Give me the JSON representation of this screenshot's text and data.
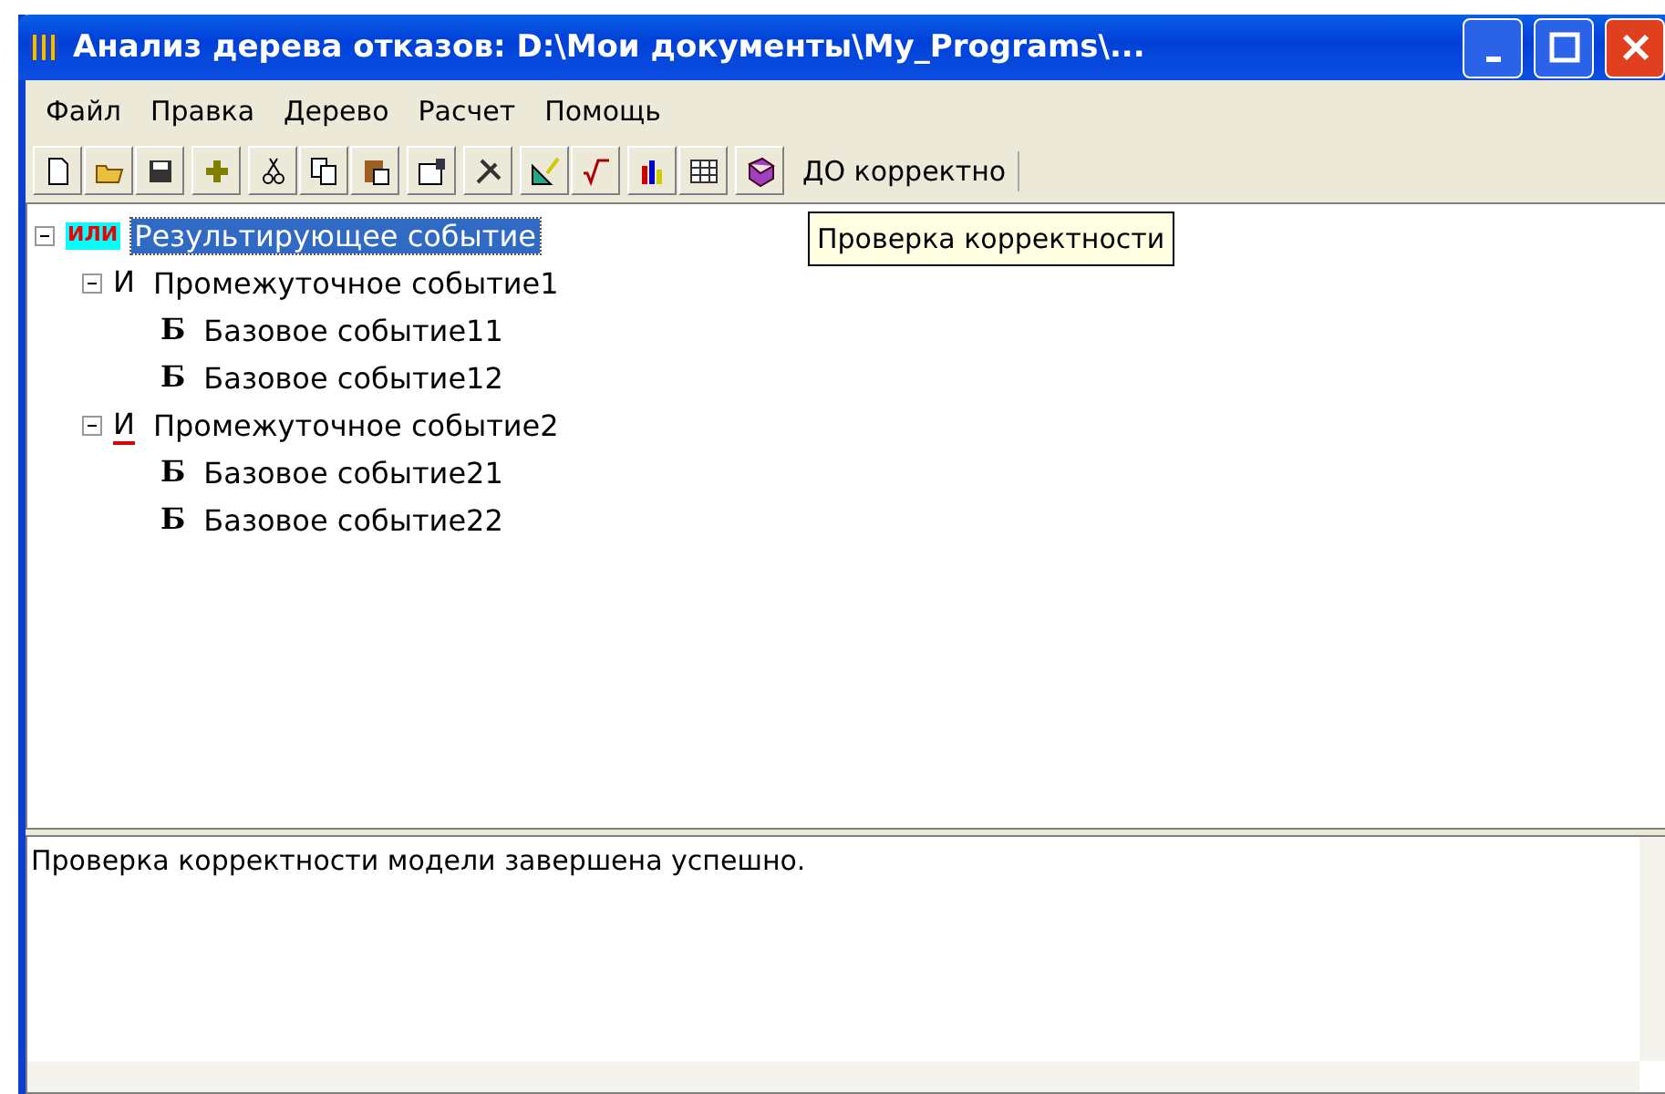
{
  "window": {
    "title": "Анализ дерева отказов: D:\\Мои документы\\My_Programs\\..."
  },
  "menu": [
    {
      "label": "Файл"
    },
    {
      "label": "Правка"
    },
    {
      "label": "Дерево"
    },
    {
      "label": "Расчет"
    },
    {
      "label": "Помощь"
    }
  ],
  "toolbar": {
    "status": "ДО корректно"
  },
  "tooltip": "Проверка корректности",
  "tree": [
    {
      "gate": "ИЛИ",
      "kind": "or",
      "label": "Результирующее событие",
      "selected": true,
      "expanded": true,
      "underlined": false,
      "children": [
        {
          "gate": "И",
          "kind": "and",
          "label": "Промежуточное событие1",
          "selected": false,
          "expanded": true,
          "underlined": false,
          "children": [
            {
              "gate": "Б",
              "kind": "basic",
              "label": "Базовое событие11",
              "selected": false,
              "underlined": false
            },
            {
              "gate": "Б",
              "kind": "basic",
              "label": "Базовое событие12",
              "selected": false,
              "underlined": false
            }
          ]
        },
        {
          "gate": "И",
          "kind": "and",
          "label": "Промежуточное событие2",
          "selected": false,
          "expanded": true,
          "underlined": true,
          "children": [
            {
              "gate": "Б",
              "kind": "basic",
              "label": "Базовое событие21",
              "selected": false,
              "underlined": false
            },
            {
              "gate": "Б",
              "kind": "basic",
              "label": "Базовое событие22",
              "selected": false,
              "underlined": false
            }
          ]
        }
      ]
    }
  ],
  "log": {
    "text": "Проверка корректности модели завершена успешно."
  }
}
